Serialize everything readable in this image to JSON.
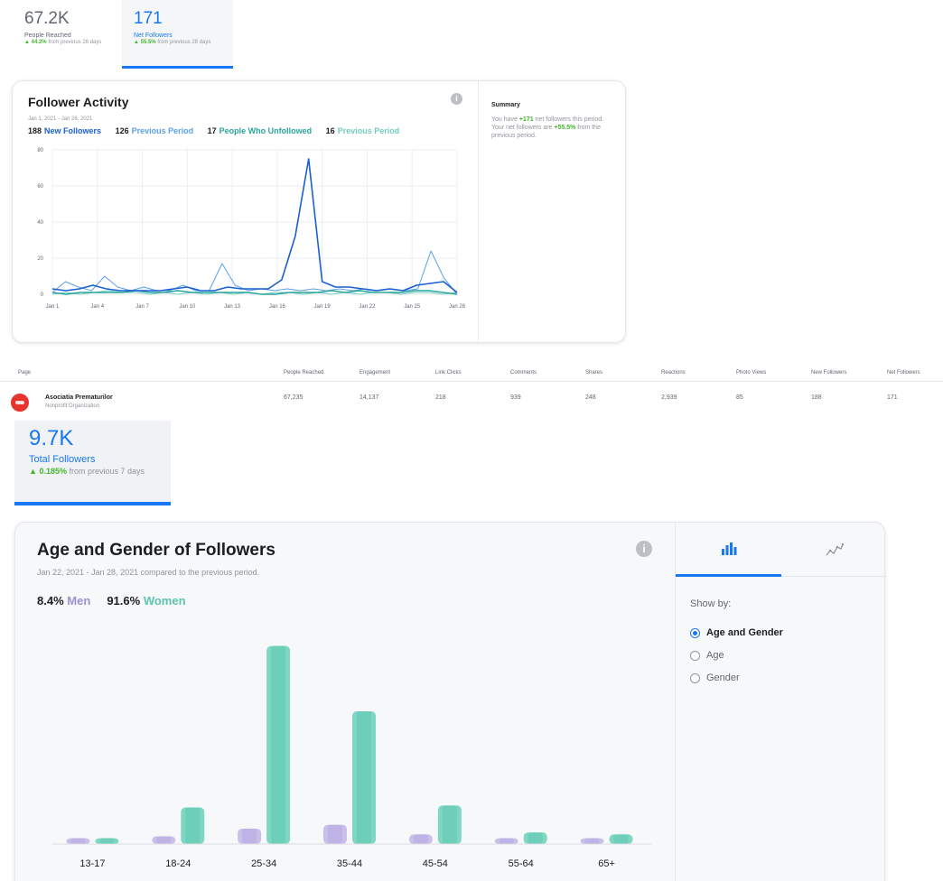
{
  "top_metrics": {
    "reached": {
      "value": "67.2K",
      "label": "People Reached",
      "change": "44.2%",
      "change_text": "from previous 28 days"
    },
    "net": {
      "value": "171",
      "label": "Net Followers",
      "change": "55.5%",
      "change_text": "from previous 28 days"
    }
  },
  "follower_activity": {
    "title": "Follower Activity",
    "info_icon": "info-icon",
    "date_range": "Jan 1, 2021 - Jan 28, 2021",
    "legend": [
      {
        "count": "188",
        "label": "New Followers",
        "color": "#1a5fd3"
      },
      {
        "count": "126",
        "label": "Previous Period",
        "color": "#5aa0ec"
      },
      {
        "count": "17",
        "label": "People Who Unfollowed",
        "color": "#2aa59c"
      },
      {
        "count": "16",
        "label": "Previous Period",
        "color": "#72cdc0"
      }
    ],
    "summary": {
      "title": "Summary",
      "text_1": "You have ",
      "net": "+171",
      "text_2": " net followers this period. Your net followers are ",
      "pct": "+55.5%",
      "text_3": " from the previous period."
    }
  },
  "chart_data": [
    {
      "type": "line",
      "title": "Follower Activity",
      "x": [
        "Jan 1",
        "Jan 2",
        "Jan 3",
        "Jan 4",
        "Jan 5",
        "Jan 6",
        "Jan 7",
        "Jan 8",
        "Jan 9",
        "Jan 10",
        "Jan 11",
        "Jan 12",
        "Jan 13",
        "Jan 14",
        "Jan 15",
        "Jan 16",
        "Jan 17",
        "Jan 18",
        "Jan 19",
        "Jan 20",
        "Jan 21",
        "Jan 22",
        "Jan 23",
        "Jan 24",
        "Jan 25",
        "Jan 26",
        "Jan 27",
        "Jan 28"
      ],
      "x_ticks": [
        "Jan 1",
        "Jan 4",
        "Jan 7",
        "Jan 10",
        "Jan 13",
        "Jan 16",
        "Jan 19",
        "Jan 22",
        "Jan 25",
        "Jan 28"
      ],
      "y_ticks": [
        0,
        20,
        40,
        60,
        80
      ],
      "ylim": [
        0,
        80
      ],
      "grid": true,
      "series": [
        {
          "name": "New Followers",
          "color": "#1a5fd3",
          "values": [
            3,
            2,
            3,
            5,
            3,
            2,
            2,
            2,
            2,
            3,
            4,
            2,
            2,
            4,
            3,
            3,
            3,
            8,
            32,
            75,
            7,
            4,
            4,
            3,
            2,
            3,
            2,
            5,
            6,
            7,
            1
          ]
        },
        {
          "name": "Previous Period",
          "color": "#5aa0ec",
          "values": [
            1,
            7,
            4,
            2,
            10,
            4,
            2,
            4,
            2,
            2,
            5,
            2,
            2,
            17,
            5,
            2,
            3,
            2,
            3,
            2,
            3,
            2,
            3,
            2,
            3,
            2,
            3,
            2,
            3,
            24,
            9,
            0
          ]
        },
        {
          "name": "People Who Unfollowed",
          "color": "#2aa59c",
          "values": [
            1,
            0,
            1,
            1,
            1,
            1,
            2,
            1,
            1,
            2,
            1,
            1,
            1,
            1,
            1,
            0,
            0,
            1,
            1,
            1,
            2,
            1,
            2,
            1,
            1,
            1,
            2,
            2,
            1,
            0
          ]
        },
        {
          "name": "Previous Period",
          "color": "#72cdc0",
          "values": [
            0,
            1,
            0,
            1,
            2,
            1,
            1,
            0,
            1,
            0,
            1,
            0,
            1,
            0,
            1,
            0,
            1,
            1,
            0,
            1,
            0,
            1,
            0,
            1,
            1,
            0,
            1,
            1,
            0,
            1
          ]
        }
      ]
    },
    {
      "type": "bar",
      "title": "Age and Gender of Followers",
      "categories": [
        "13-17",
        "18-24",
        "25-34",
        "35-44",
        "45-54",
        "55-64",
        "65+"
      ],
      "series": [
        {
          "name": "Men",
          "color": "#c9bfeb",
          "values": [
            0.3,
            0.4,
            0.8,
            1.0,
            0.5,
            0.3,
            0.3
          ]
        },
        {
          "name": "Women",
          "color": "#7ed6c3",
          "values": [
            0.3,
            1.9,
            10.3,
            6.9,
            2.0,
            0.6,
            0.5
          ]
        }
      ],
      "ylim": [
        0,
        10.8
      ],
      "grid": false
    }
  ],
  "table": {
    "headers": [
      "Page",
      "People Reached",
      "Engagement",
      "Link Clicks",
      "Comments",
      "Shares",
      "Reactions",
      "Photo Views",
      "New Followers",
      "Net Followers"
    ],
    "row": {
      "page_name": "Asociatia Prematurilor",
      "page_type": "Nonprofit Organization",
      "values": [
        "67,235",
        "14,137",
        "218",
        "939",
        "248",
        "2,939",
        "85",
        "188",
        "171"
      ]
    }
  },
  "total_followers": {
    "value": "9.7K",
    "label": "Total Followers",
    "change": "0.185%",
    "change_text": "from previous 7 days"
  },
  "age_gender": {
    "title": "Age and Gender of Followers",
    "subtitle": "Jan 22, 2021 - Jan 28, 2021 compared to the previous period.",
    "men_pct": "8.4%",
    "men_label": "Men",
    "women_pct": "91.6%",
    "women_label": "Women",
    "show_by": "Show by:",
    "options": [
      "Age and Gender",
      "Age",
      "Gender"
    ],
    "selected": "Age and Gender",
    "tab_icons": [
      "bar-chart-icon",
      "line-chart-icon"
    ]
  },
  "colors": {
    "accent": "#1877f2",
    "positive": "#42b72a"
  }
}
